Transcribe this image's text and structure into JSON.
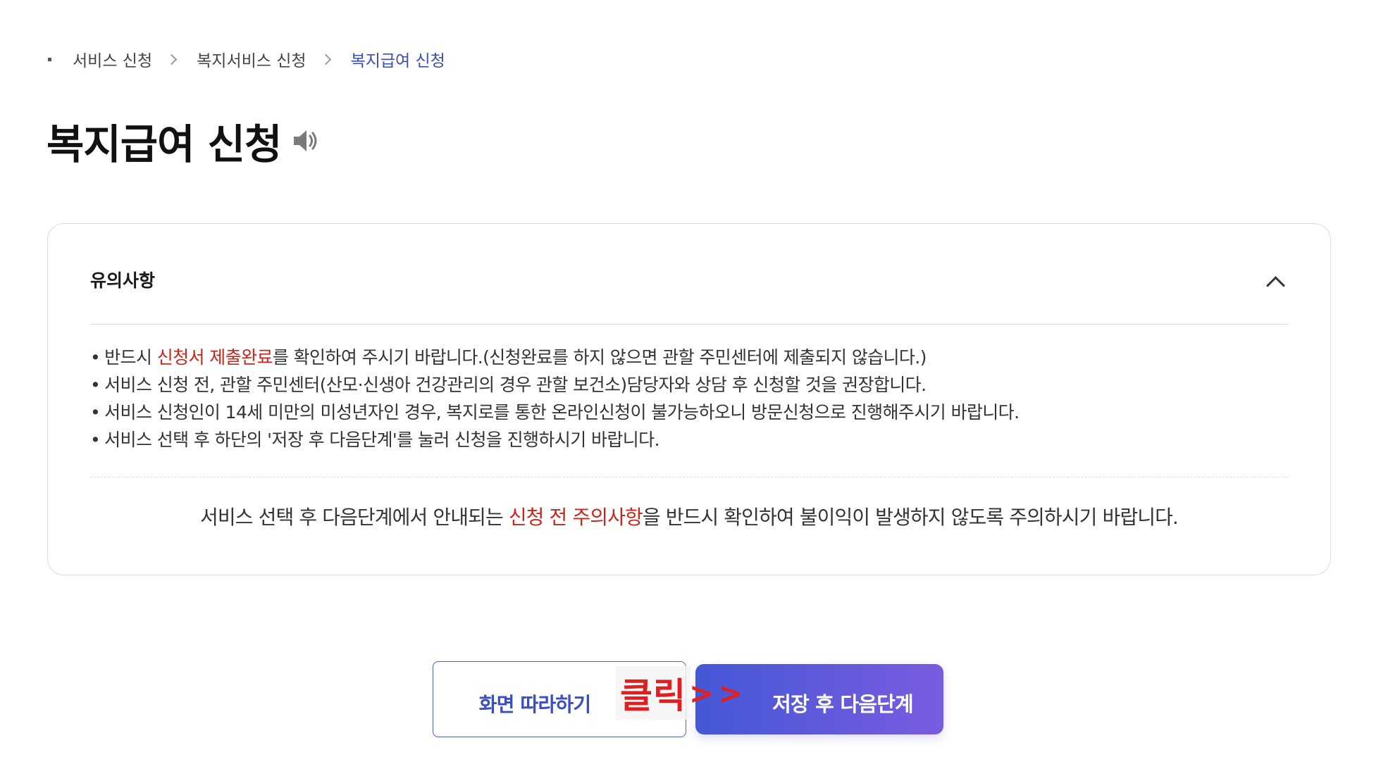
{
  "breadcrumb": {
    "items": [
      {
        "label": "서비스 신청"
      },
      {
        "label": "복지서비스 신청"
      },
      {
        "label": "복지급여 신청"
      }
    ]
  },
  "page": {
    "title": "복지급여 신청",
    "speaker_icon": "speaker-icon"
  },
  "notice": {
    "title": "유의사항",
    "toggle_icon": "chevron-up-icon",
    "items": [
      {
        "before": "반드시 ",
        "highlight": "신청서 제출완료",
        "after": "를 확인하여 주시기 바랍니다.(신청완료를 하지 않으면 관할 주민센터에 제출되지 않습니다.)"
      },
      {
        "text": "서비스 신청 전, 관할 주민센터(산모·신생아 건강관리의 경우 관할 보건소)담당자와 상담 후 신청할 것을 권장합니다."
      },
      {
        "text": "서비스 신청인이 14세 미만의 미성년자인 경우, 복지로를 통한 온라인신청이 불가능하오니 방문신청으로 진행해주시기 바랍니다."
      },
      {
        "text": "서비스 선택 후 하단의 '저장 후 다음단계'를 눌러 신청을 진행하시기 바랍니다."
      }
    ],
    "footer": {
      "before": "서비스 선택 후 다음단계에서 안내되는 ",
      "highlight": "신청 전 주의사항",
      "after": "을 반드시 확인하여 불이익이 발생하지 않도록 주의하시기 바랍니다."
    },
    "highlight_color": "#c8261b"
  },
  "buttons": {
    "follow_label": "화면 따라하기",
    "next_label": "저장 후 다음단계"
  },
  "annotation": {
    "text": "클릭",
    "arrows": ">>"
  },
  "colors": {
    "accent": "#3c4fb0",
    "button_gradient_start": "#4458d6",
    "button_gradient_end": "#7a5ce0",
    "annotation": "#e02020"
  }
}
